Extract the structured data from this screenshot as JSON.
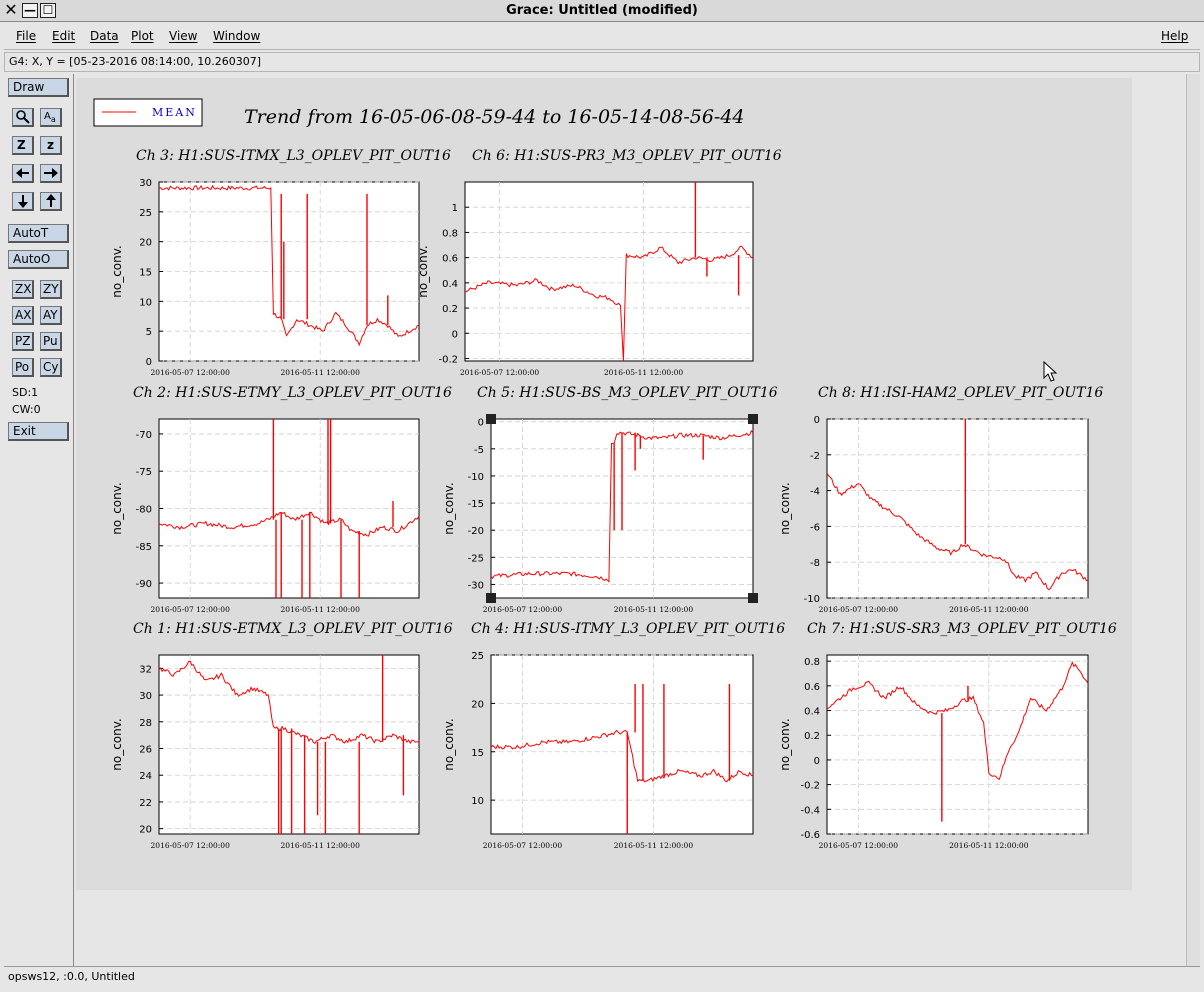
{
  "window": {
    "title": "Grace: Untitled (modified)",
    "close_glyph": "✕",
    "min_glyph": "—",
    "max_glyph": "☐"
  },
  "menu": {
    "file": "File",
    "edit": "Edit",
    "data": "Data",
    "plot": "Plot",
    "view": "View",
    "window": "Window",
    "help": "Help"
  },
  "locator": "G4: X, Y = [05-23-2016 08:14:00, 10.260307]",
  "toolbar": {
    "draw": "Draw",
    "autot": "AutoT",
    "autoo": "AutoO",
    "zx": "ZX",
    "zy": "ZY",
    "ax": "AX",
    "ay": "AY",
    "pz": "PZ",
    "pu": "Pu",
    "po": "Po",
    "cy": "Cy",
    "sd": "SD:1",
    "cw": "CW:0",
    "exit": "Exit",
    "zoom_z": "Z",
    "zoom_z_small": "z",
    "text_glyph": "A",
    "icons": [
      "magnifier-icon",
      "text-icon",
      "zoom-in-icon",
      "zoom-out-icon",
      "arrow-left-icon",
      "arrow-right-icon",
      "arrow-down-icon",
      "arrow-up-icon"
    ]
  },
  "status": "opsws12, :0.0, Untitled",
  "plot": {
    "main_title": "Trend from 16-05-06-08-59-44 to 16-05-14-08-56-44",
    "legend": "MEAN",
    "line_color": "#ff0000",
    "ylabel": "no_conv.",
    "xticks": [
      "2016-05-07 12:00:00",
      "2016-05-11 12:00:00"
    ],
    "xtick_pos": [
      0.12,
      0.62
    ]
  },
  "chart_data": [
    {
      "type": "line",
      "title": "Ch 3: H1:SUS-ITMX_L3_OPLEV_PIT_OUT16",
      "ylabel": "no_conv.",
      "ylim": [
        0,
        30
      ],
      "yticks": [
        0,
        5,
        10,
        15,
        20,
        25,
        30
      ],
      "ytick_labels": [
        "0",
        "5",
        "10",
        "15",
        "20",
        "25",
        "30"
      ],
      "grid": true,
      "x": [
        0,
        0.43,
        0.44,
        0.47,
        0.49,
        0.53,
        0.58,
        0.63,
        0.68,
        0.72,
        0.77,
        0.8,
        0.84,
        0.88,
        0.92,
        0.96,
        1
      ],
      "y": [
        29,
        29,
        8,
        7,
        4,
        7,
        6,
        5,
        8,
        6,
        3,
        6,
        7,
        6,
        4,
        5,
        6
      ],
      "spikes": [
        {
          "x": 0.43,
          "y": 29
        },
        {
          "x": 0.47,
          "y": 28
        },
        {
          "x": 0.48,
          "y": 20
        },
        {
          "x": 0.57,
          "y": 28
        },
        {
          "x": 0.8,
          "y": 28
        },
        {
          "x": 0.88,
          "y": 11
        }
      ]
    },
    {
      "type": "line",
      "title": "Ch 6: H1:SUS-PR3_M3_OPLEV_PIT_OUT16",
      "ylabel": "no_conv.",
      "ylim": [
        -0.22,
        1.2
      ],
      "yticks": [
        -0.2,
        0,
        0.2,
        0.4,
        0.6,
        0.8,
        1
      ],
      "ytick_labels": [
        "-0.2",
        "0",
        "0.2",
        "0.4",
        "0.6",
        "0.8",
        "1"
      ],
      "grid": true,
      "x": [
        0,
        0.08,
        0.18,
        0.25,
        0.3,
        0.38,
        0.45,
        0.5,
        0.54,
        0.55,
        0.56,
        0.62,
        0.68,
        0.74,
        0.8,
        0.86,
        0.92,
        0.96,
        1
      ],
      "y": [
        0.33,
        0.4,
        0.38,
        0.42,
        0.35,
        0.38,
        0.3,
        0.28,
        0.22,
        -0.22,
        0.62,
        0.6,
        0.68,
        0.56,
        0.6,
        0.58,
        0.62,
        0.68,
        0.6
      ],
      "spikes": [
        {
          "x": 0.55,
          "y": -0.22
        },
        {
          "x": 0.8,
          "y": 1.2
        },
        {
          "x": 0.84,
          "y": 0.45
        },
        {
          "x": 0.95,
          "y": 0.3
        }
      ]
    },
    {
      "type": "line",
      "title": "Ch 2: H1:SUS-ETMY_L3_OPLEV_PIT_OUT16",
      "ylabel": "no_conv.",
      "ylim": [
        -92,
        -68
      ],
      "yticks": [
        -90,
        -85,
        -80,
        -75,
        -70
      ],
      "ytick_labels": [
        "-90",
        "-85",
        "-80",
        "-75",
        "-70"
      ],
      "grid": true,
      "x": [
        0,
        0.08,
        0.18,
        0.28,
        0.38,
        0.42,
        0.47,
        0.52,
        0.58,
        0.64,
        0.7,
        0.74,
        0.8,
        0.86,
        0.92,
        0.96,
        1
      ],
      "y": [
        -82,
        -82.5,
        -82,
        -82.5,
        -82,
        -81.5,
        -80.5,
        -81.5,
        -80.5,
        -82,
        -81.5,
        -83,
        -83.5,
        -82.5,
        -83,
        -82,
        -81
      ],
      "spikes": [
        {
          "x": 0.44,
          "y": -68
        },
        {
          "x": 0.45,
          "y": -92
        },
        {
          "x": 0.47,
          "y": -92
        },
        {
          "x": 0.55,
          "y": -92
        },
        {
          "x": 0.58,
          "y": -92
        },
        {
          "x": 0.65,
          "y": -68
        },
        {
          "x": 0.66,
          "y": -68
        },
        {
          "x": 0.7,
          "y": -92
        },
        {
          "x": 0.77,
          "y": -92
        },
        {
          "x": 0.9,
          "y": -79
        }
      ]
    },
    {
      "type": "line",
      "title": "Ch 5: H1:SUS-BS_M3_OPLEV_PIT_OUT16",
      "ylabel": "no_conv.",
      "ylim": [
        -32.5,
        0.5
      ],
      "yticks": [
        -30,
        -25,
        -20,
        -15,
        -10,
        -5,
        0
      ],
      "ytick_labels": [
        "-30",
        "-25",
        "-20",
        "-15",
        "-10",
        "-5",
        "0"
      ],
      "grid": true,
      "x": [
        0,
        0.15,
        0.3,
        0.4,
        0.44,
        0.45,
        0.46,
        0.47,
        0.48,
        0.5,
        0.56,
        0.6,
        0.66,
        0.72,
        0.8,
        0.88,
        0.94,
        1
      ],
      "y": [
        -28.5,
        -28,
        -28,
        -28.5,
        -29,
        -29.5,
        -4,
        -4,
        -2,
        -2,
        -2.5,
        -3,
        -3,
        -2.5,
        -2.5,
        -3,
        -2.5,
        -2
      ],
      "spikes": [
        {
          "x": 0.47,
          "y": -20
        },
        {
          "x": 0.5,
          "y": -20
        },
        {
          "x": 0.55,
          "y": -9
        },
        {
          "x": 0.57,
          "y": -5
        },
        {
          "x": 0.81,
          "y": -7
        }
      ]
    },
    {
      "type": "line",
      "title": "Ch 8: H1:ISI-HAM2_OPLEV_PIT_OUT16",
      "ylabel": "no_conv.",
      "ylim": [
        -10,
        0
      ],
      "yticks": [
        -10,
        -8,
        -6,
        -4,
        -2,
        0
      ],
      "ytick_labels": [
        "-10",
        "-8",
        "-6",
        "-4",
        "-2",
        "0"
      ],
      "grid": true,
      "x": [
        0,
        0.05,
        0.12,
        0.17,
        0.28,
        0.35,
        0.42,
        0.48,
        0.52,
        0.6,
        0.68,
        0.72,
        0.76,
        0.8,
        0.85,
        0.9,
        0.94,
        1
      ],
      "y": [
        -3,
        -4.2,
        -3.6,
        -4.5,
        -5.5,
        -6.5,
        -7.2,
        -7.5,
        -7,
        -7.6,
        -7.8,
        -8.8,
        -9,
        -8.6,
        -9.5,
        -8.6,
        -8.4,
        -9
      ],
      "spikes": [
        {
          "x": 0.53,
          "y": 0
        }
      ]
    },
    {
      "type": "line",
      "title": "Ch 1: H1:SUS-ETMX_L3_OPLEV_PIT_OUT16",
      "ylabel": "no_conv.",
      "ylim": [
        19.6,
        33
      ],
      "yticks": [
        20,
        22,
        24,
        26,
        28,
        30,
        32
      ],
      "ytick_labels": [
        "20",
        "22",
        "24",
        "26",
        "28",
        "30",
        "32"
      ],
      "grid": true,
      "x": [
        0,
        0.06,
        0.12,
        0.18,
        0.24,
        0.3,
        0.36,
        0.42,
        0.44,
        0.48,
        0.54,
        0.6,
        0.66,
        0.72,
        0.78,
        0.84,
        0.9,
        0.96,
        1
      ],
      "y": [
        32,
        31.5,
        32.5,
        31,
        31.5,
        30,
        30.5,
        30,
        27.5,
        27.5,
        27,
        26.5,
        27,
        26.5,
        27,
        26.5,
        27,
        26.5,
        26.5
      ],
      "spikes": [
        {
          "x": 0.46,
          "y": 19.6
        },
        {
          "x": 0.47,
          "y": 19.6
        },
        {
          "x": 0.51,
          "y": 19.6
        },
        {
          "x": 0.56,
          "y": 19.6
        },
        {
          "x": 0.61,
          "y": 21
        },
        {
          "x": 0.64,
          "y": 19.6
        },
        {
          "x": 0.77,
          "y": 19.6
        },
        {
          "x": 0.86,
          "y": 33
        },
        {
          "x": 0.94,
          "y": 22.5
        }
      ]
    },
    {
      "type": "line",
      "title": "Ch 4: H1:SUS-ITMY_L3_OPLEV_PIT_OUT16",
      "ylabel": "no_conv.",
      "ylim": [
        6.5,
        25
      ],
      "yticks": [
        10,
        15,
        20,
        25
      ],
      "ytick_labels": [
        "10",
        "15",
        "20",
        "25"
      ],
      "grid": true,
      "x": [
        0,
        0.1,
        0.2,
        0.3,
        0.4,
        0.48,
        0.52,
        0.56,
        0.6,
        0.66,
        0.72,
        0.8,
        0.85,
        0.9,
        0.95,
        1
      ],
      "y": [
        15.5,
        15.5,
        16,
        16,
        16.5,
        17,
        17,
        12,
        12,
        12.5,
        13,
        12.5,
        13,
        12,
        13,
        12.5
      ],
      "spikes": [
        {
          "x": 0.52,
          "y": 6.5
        },
        {
          "x": 0.55,
          "y": 22
        },
        {
          "x": 0.58,
          "y": 22
        },
        {
          "x": 0.66,
          "y": 22
        },
        {
          "x": 0.91,
          "y": 22
        }
      ]
    },
    {
      "type": "line",
      "title": "Ch 7: H1:SUS-SR3_M3_OPLEV_PIT_OUT16",
      "ylabel": "no_conv.",
      "ylim": [
        -0.6,
        0.85
      ],
      "yticks": [
        -0.6,
        -0.4,
        -0.2,
        0,
        0.2,
        0.4,
        0.6,
        0.8
      ],
      "ytick_labels": [
        "-0.6",
        "-0.4",
        "-0.2",
        "0",
        "0.2",
        "0.4",
        "0.6",
        "0.8"
      ],
      "grid": true,
      "x": [
        0,
        0.05,
        0.1,
        0.16,
        0.22,
        0.28,
        0.34,
        0.4,
        0.46,
        0.52,
        0.56,
        0.6,
        0.62,
        0.66,
        0.7,
        0.73,
        0.78,
        0.84,
        0.9,
        0.94,
        0.97,
        1
      ],
      "y": [
        0.42,
        0.5,
        0.58,
        0.62,
        0.5,
        0.6,
        0.45,
        0.38,
        0.4,
        0.48,
        0.5,
        0.3,
        -0.1,
        -0.15,
        0.1,
        0.2,
        0.5,
        0.4,
        0.58,
        0.78,
        0.72,
        0.62
      ],
      "spikes": [
        {
          "x": 0.44,
          "y": -0.5
        },
        {
          "x": 0.54,
          "y": 0.6
        }
      ]
    }
  ]
}
